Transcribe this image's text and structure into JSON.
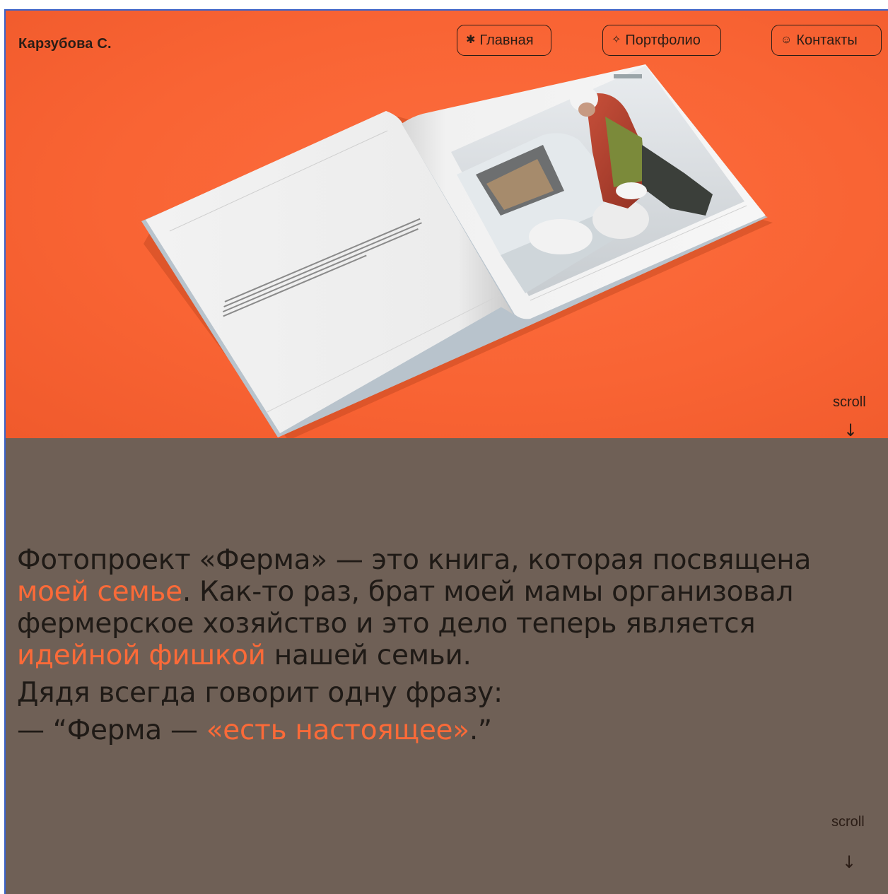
{
  "header": {
    "brand": "Карзубова С.",
    "nav": [
      {
        "icon": "asterisk-icon",
        "glyph": "✱",
        "label": "Главная"
      },
      {
        "icon": "sparkle-icon",
        "glyph": "✧",
        "label": "Портфолио"
      },
      {
        "icon": "smiley-icon",
        "glyph": "☺",
        "label": "Контакты"
      }
    ]
  },
  "hero": {
    "background_color": "#f96434",
    "image": "photo-book-mockup",
    "scroll_label": "scroll",
    "scroll_arrow": "↓"
  },
  "story": {
    "background_color": "#6f6056",
    "accent_color": "#fb6a38",
    "p1_a": "Фотопроект «Ферма» — это книга, которая посвящена ",
    "p1_hl1": "моей семье",
    "p1_b": ". Как-то раз, брат моей мамы организовал фермерское хозяйство и это дело теперь является ",
    "p1_hl2": "идейной фишкой",
    "p1_c": " нашей семьи.",
    "p2": "Дядя всегда говорит одну фразу:",
    "p3_a": "— “Ферма — ",
    "p3_hl": "«есть настоящее»",
    "p3_b": ".”",
    "scroll_label": "scroll",
    "scroll_arrow": "↓"
  }
}
